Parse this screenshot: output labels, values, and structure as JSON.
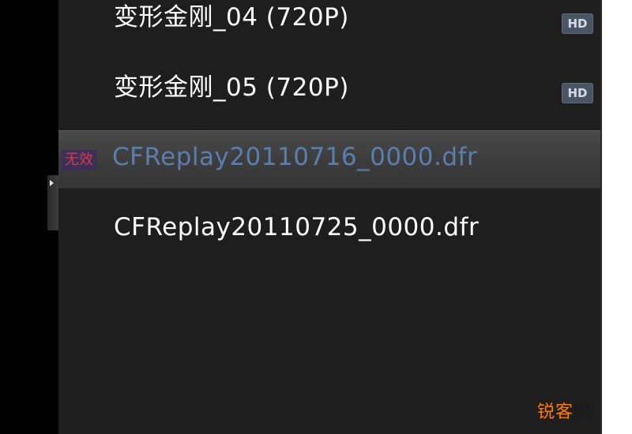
{
  "playlist": {
    "items": [
      {
        "title": "变形金刚_04 (720P)",
        "badge": "HD"
      },
      {
        "title": "变形金刚_05 (720P)",
        "badge": "HD"
      },
      {
        "title": "CFReplay20110716_0000.dfr",
        "status": "无效",
        "selected": true
      },
      {
        "title": "CFReplay20110725_0000.dfr"
      }
    ]
  },
  "watermark": {
    "part1": "锐",
    "part2": "客",
    "part3": "网"
  },
  "colors": {
    "panel_background": "#1e1e1e",
    "selected_text": "#5a7fae",
    "invalid_text": "#d53a4b",
    "watermark": "#ff7a00"
  },
  "icons": {
    "collapse_handle": "triangle-right-icon"
  }
}
